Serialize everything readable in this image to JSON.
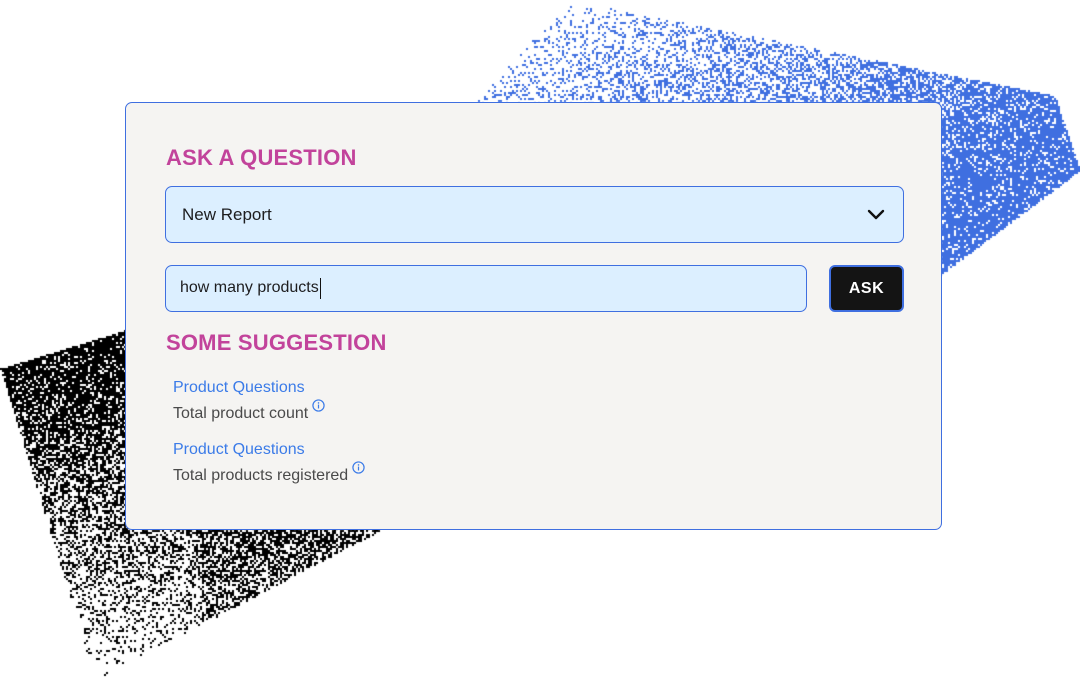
{
  "panel": {
    "ask_heading": "ASK A QUESTION",
    "report_select": {
      "value": "New Report",
      "icon": "chevron-down-icon"
    },
    "query_input": {
      "value": "how many products"
    },
    "ask_button_label": "ASK",
    "suggestions_heading": "SOME SUGGESTION",
    "suggestions": [
      {
        "category": "Product Questions",
        "question": "Total product count",
        "icon": "info-icon"
      },
      {
        "category": "Product Questions",
        "question": "Total products registered",
        "icon": "info-icon"
      }
    ]
  },
  "colors": {
    "accent_blue": "#3f6fe0",
    "heading_magenta": "#c2439b",
    "field_bg": "#dcefff",
    "panel_bg": "#f5f4f2",
    "button_bg": "#141414",
    "link_blue": "#3b7be8"
  }
}
